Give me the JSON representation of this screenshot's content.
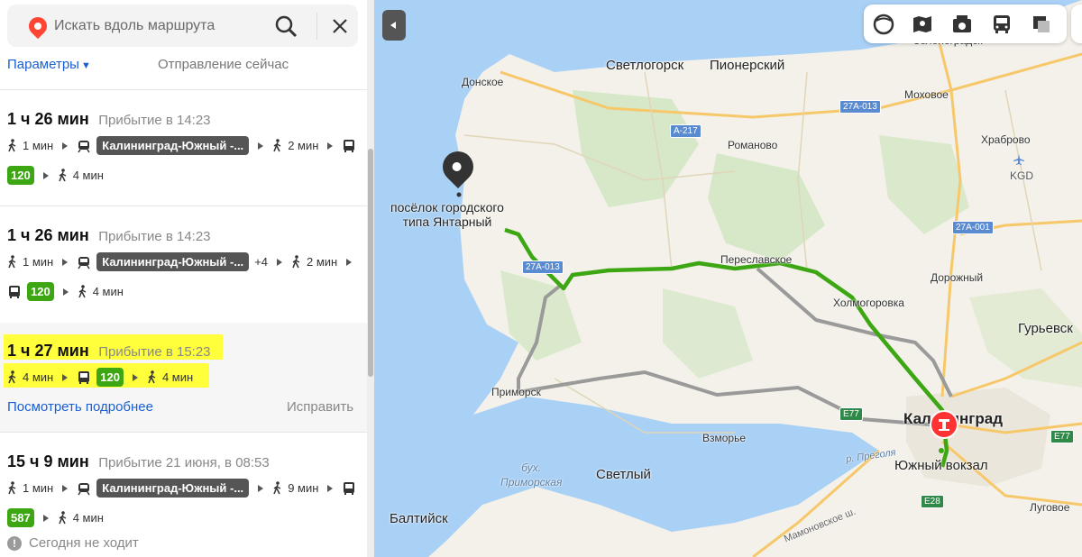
{
  "search": {
    "placeholder": "Искать вдоль маршрута"
  },
  "options": {
    "params_label": "Параметры",
    "departure_label": "Отправление сейчас"
  },
  "routes": [
    {
      "duration": "1 ч 26 мин",
      "arrival": "Прибытие в 14:23",
      "walk1": "1 мин",
      "train": "Калининград-Южный -...",
      "walk2": "2 мин",
      "bus": "120",
      "walk3": "4 мин"
    },
    {
      "duration": "1 ч 26 мин",
      "arrival": "Прибытие в 14:23",
      "walk1": "1 мин",
      "train": "Калининград-Южный -...",
      "extra": "+4",
      "walk2": "2 мин",
      "bus": "120",
      "walk3": "4 мин"
    },
    {
      "duration": "1 ч 27 мин",
      "arrival": "Прибытие в 15:23",
      "walk1": "4 мин",
      "bus": "120",
      "walk2": "4 мин",
      "details_link": "Посмотреть подробнее",
      "fix_link": "Исправить"
    },
    {
      "duration": "15 ч 9 мин",
      "arrival": "Прибытие 21 июня, в 08:53",
      "walk1": "1 мин",
      "train": "Калининград-Южный -...",
      "walk2": "9 мин",
      "bus": "587",
      "walk3": "4 мин",
      "notice": "Сегодня не ходит"
    }
  ],
  "map": {
    "places": {
      "zelenogradsk": "Зеленоградск",
      "svetlogorsk": "Светлогорск",
      "pionersky": "Пионерский",
      "donskoe": "Донское",
      "mokhovoe": "Моховое",
      "khrabrovo": "Храброво",
      "airport": "KGD",
      "romanovo": "Романово",
      "yantarny": "посёлок городского\nтипа Янтарный",
      "pereslavskoe": "Переславское",
      "kholmogorovka": "Холмогоровка",
      "dorozhny": "Дорожный",
      "gurievsk": "Гурьевск",
      "primorsk": "Приморск",
      "kaliningrad": "Калининград",
      "vzmorye": "Взморье",
      "yuzhny": "Южный вокзал",
      "bay": "бух.\nПриморская",
      "svetly": "Светлый",
      "baltiysk": "Балтийск",
      "lugovoe": "Луговое",
      "pregolya": "р. Преголя",
      "mamonovskoe": "Мамоновское ш."
    },
    "roads": {
      "r1": "27А-013",
      "r2": "А-217",
      "r3": "27А-013",
      "r4": "27А-001",
      "r5": "E77",
      "r6": "E77",
      "r7": "E28"
    },
    "colors": {
      "route_active": "#3da613",
      "route_alt": "#9a9a9a",
      "sea": "#a9d0f5",
      "land": "#f3f1ea"
    }
  },
  "icons": {
    "toolbar": [
      "layers-icon",
      "map-panorama-icon",
      "camera-icon",
      "transit-icon",
      "overlay-icon"
    ]
  }
}
